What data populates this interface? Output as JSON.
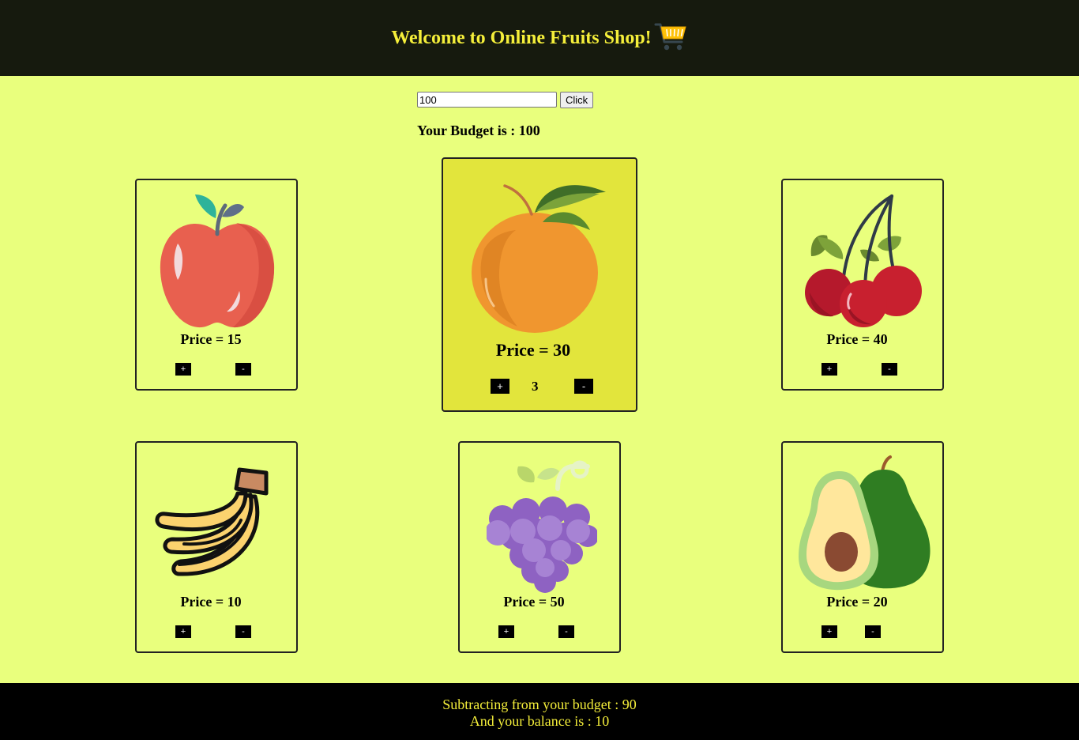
{
  "header": {
    "title": "Welcome to Online Fruits Shop!",
    "icon": "shopping-cart-icon"
  },
  "budget_form": {
    "input_value": "100",
    "button_label": "Click"
  },
  "budget_text": "Your Budget is : 100",
  "products": [
    {
      "name": "apple",
      "price_label": "Price = 15",
      "plus": "+",
      "minus": "-"
    },
    {
      "name": "orange",
      "price_label": "Price = 30",
      "plus": "+",
      "minus": "-",
      "quantity": "3"
    },
    {
      "name": "cherry",
      "price_label": "Price = 40",
      "plus": "+",
      "minus": "-"
    },
    {
      "name": "banana",
      "price_label": "Price = 10",
      "plus": "+",
      "minus": "-"
    },
    {
      "name": "grapes",
      "price_label": "Price = 50",
      "plus": "+",
      "minus": "-"
    },
    {
      "name": "avocado",
      "price_label": "Price = 20",
      "plus": "+",
      "minus": "-"
    }
  ],
  "footer": {
    "subtract_text": "Subtracting from your budget : 90",
    "balance_text": "And your balance is : 10"
  },
  "colors": {
    "page_bg": "#e9ff7d",
    "header_bg": "#161a0e",
    "accent_text": "#f5ef3a",
    "selected_card": "#e2e53c"
  }
}
